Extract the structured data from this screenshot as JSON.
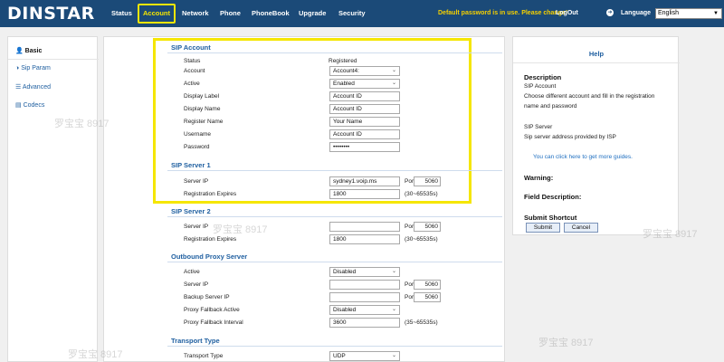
{
  "brand": "DINSTAR",
  "nav": [
    "Status",
    "Account",
    "Network",
    "Phone",
    "PhoneBook",
    "Upgrade",
    "Security"
  ],
  "header": {
    "warning": "Default password is in use. Please change!",
    "logout": "LogOut",
    "language_label": "Language",
    "language_value": "English"
  },
  "sidebar": [
    "Basic",
    "Sip Param",
    "Advanced",
    "Codecs"
  ],
  "sections": {
    "sip_account": "SIP Account",
    "sip_server_1": "SIP Server 1",
    "sip_server_2": "SIP Server 2",
    "outbound_proxy": "Outbound Proxy Server",
    "transport": "Transport Type"
  },
  "fields": {
    "status_label": "Status",
    "status_value": "Registered",
    "account_label": "Account",
    "account_value": "Account4:",
    "active_label": "Active",
    "active_value": "Enabled",
    "display_label_label": "Display Label",
    "display_label_value": "Account ID",
    "display_name_label": "Display Name",
    "display_name_value": "Account ID",
    "register_name_label": "Register Name",
    "register_name_value": "Your Name",
    "username_label": "Username",
    "username_value": "Account ID",
    "password_label": "Password",
    "password_value": "••••••••",
    "s1_ip_label": "Server IP",
    "s1_ip_value": "sydney1.voip.ms",
    "s1_port_label": "Port",
    "s1_port_value": "5060",
    "s1_exp_label": "Registration Expires",
    "s1_exp_value": "1800",
    "s1_exp_range": "(30~65535s)",
    "s2_ip_label": "Server IP",
    "s2_ip_value": "",
    "s2_port_label": "Port",
    "s2_port_value": "5060",
    "s2_exp_label": "Registration Expires",
    "s2_exp_value": "1800",
    "s2_exp_range": "(30~65535s)",
    "op_active_label": "Active",
    "op_active_value": "Disabled",
    "op_ip_label": "Server IP",
    "op_ip_value": "",
    "op_port_label": "Port",
    "op_port_value": "5060",
    "op_backup_label": "Backup Server IP",
    "op_backup_value": "",
    "op_backup_port_label": "Port",
    "op_backup_port_value": "5060",
    "op_fallback_label": "Proxy Fallback Active",
    "op_fallback_value": "Disabled",
    "op_interval_label": "Proxy Fallback Interval",
    "op_interval_value": "3600",
    "op_interval_range": "(35~65535s)",
    "transport_label": "Transport Type",
    "transport_value": "UDP"
  },
  "help": {
    "title": "Help",
    "desc_heading": "Description",
    "desc_1": "SIP Account",
    "desc_2": "Choose different account and fill in the registration",
    "desc_3": "name and password",
    "desc_4": "SIP Server",
    "desc_5": "Sip server address provided by ISP",
    "link": "You can click here to get more guides.",
    "warning": "Warning:",
    "field_desc": "Field Description:",
    "shortcut": "Submit Shortcut",
    "submit": "Submit",
    "cancel": "Cancel"
  },
  "watermark": "罗宝宝 8917",
  "colors": {
    "topbar": "#1b4a78",
    "accent": "#1f5fa0",
    "highlight": "#f5e600",
    "warning": "#f5d000"
  }
}
